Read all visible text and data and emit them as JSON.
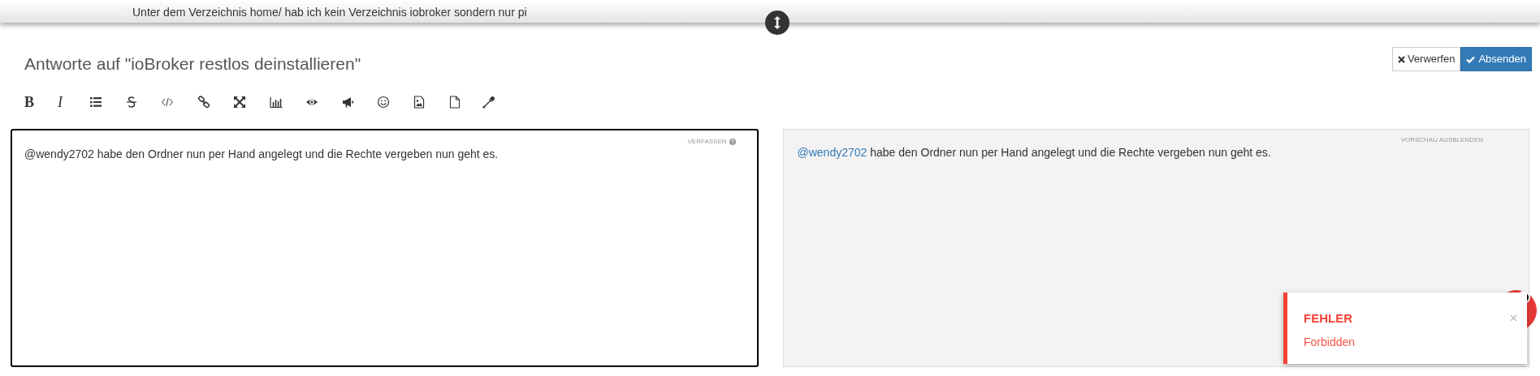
{
  "background_post": {
    "text": "Unter dem Verzeichnis home/ hab ich kein Verzeichnis iobroker sondern nur pi"
  },
  "composer": {
    "title": "Antworte auf \"ioBroker restlos deinstallieren\"",
    "buttons": [
      {
        "kind": "discard",
        "label": "Verwerfen"
      },
      {
        "kind": "submit",
        "label": "Absenden"
      }
    ],
    "toolbar": [
      {
        "kind": "bold",
        "label": "B"
      },
      {
        "kind": "italic",
        "label": "I"
      },
      {
        "kind": "list"
      },
      {
        "kind": "strike"
      },
      {
        "kind": "code"
      },
      {
        "kind": "link"
      },
      {
        "kind": "fullscreen"
      },
      {
        "kind": "chart"
      },
      {
        "kind": "eye"
      },
      {
        "kind": "megaphone"
      },
      {
        "kind": "smiley"
      },
      {
        "kind": "image"
      },
      {
        "kind": "file"
      },
      {
        "kind": "eyedropper"
      }
    ],
    "editor": {
      "hint": "VERFASSEN",
      "mention": "@wendy2702",
      "text": " habe den Ordner nun per Hand angelegt und die Rechte vergeben nun geht es."
    },
    "preview": {
      "hint": "VORSCHAU AUSBLENDEN",
      "mention": "@wendy2702",
      "text": " habe den Ordner nun per Hand angelegt und die Rechte vergeben nun geht es."
    }
  },
  "toast": {
    "title": "FEHLER",
    "message": "Forbidden"
  }
}
